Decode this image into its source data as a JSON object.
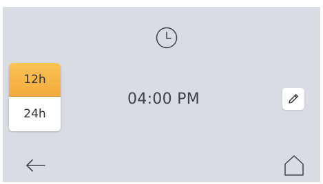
{
  "header": {
    "icon": "clock-icon"
  },
  "format_toggle": {
    "options": [
      {
        "label": "12h",
        "selected": true
      },
      {
        "label": "24h",
        "selected": false
      }
    ],
    "selected_color": "#f6b445"
  },
  "time_display": {
    "value": "04:00 PM"
  },
  "edit": {
    "icon": "pencil-icon"
  },
  "footer": {
    "back_icon": "arrow-left-icon",
    "home_icon": "home-icon"
  },
  "colors": {
    "panel_background": "#d9dde3",
    "text": "#3f4145"
  }
}
